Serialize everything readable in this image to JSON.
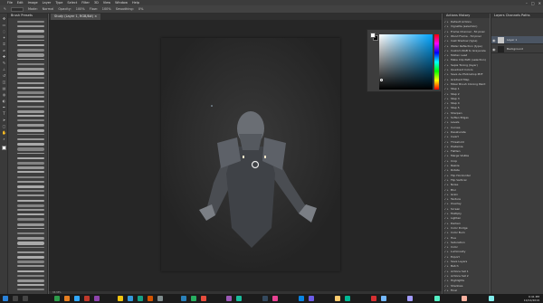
{
  "menubar": {
    "items": [
      "File",
      "Edit",
      "Image",
      "Layer",
      "Type",
      "Select",
      "Filter",
      "3D",
      "View",
      "Window",
      "Help"
    ]
  },
  "optionsbar": {
    "mode_label": "Mode:",
    "mode_value": "Normal",
    "opacity_label": "Opacity:",
    "opacity_value": "100%",
    "flow_label": "Flow:",
    "flow_value": "100%",
    "smoothing_label": "Smoothing:",
    "smoothing_value": "0%"
  },
  "brush_panel": {
    "title": "Brush Presets"
  },
  "document": {
    "tab_title": "Study (Layer 1, RGB/8#) ×"
  },
  "status": {
    "zoom": "33.33%"
  },
  "color": {
    "foreground": "#ffffff",
    "background": "#000000",
    "hue_accent": "#00a5ff"
  },
  "actions_panel": {
    "tabs": [
      "Actions",
      "History"
    ],
    "items": [
      "Default Actions",
      "Vignette (selection)",
      "Frame Channel - 50 pixel",
      "Wood Frame - 50 pixel",
      "Cast Shadow (type)",
      "Water Reflection (type)",
      "Custom RGB to Grayscale",
      "Molten Lead",
      "Make Clip Path (selection)",
      "Sepia Toning (layer)",
      "Quadrant Colors",
      "Save As Photoshop PDF",
      "Gradient Map",
      "Mixer Brush Cloning Paint",
      "Step 1",
      "Step 2",
      "Step 3",
      "Step 4",
      "Step 5",
      "Sharpen",
      "Soften Edges",
      "Levels",
      "Curves",
      "Desaturate",
      "Invert",
      "Threshold",
      "Posterize",
      "Flatten",
      "Merge Visible",
      "Crop",
      "Resize",
      "Rotate",
      "Flip Horizontal",
      "Flip Vertical",
      "Noise",
      "Blur",
      "Grain",
      "Texture",
      "Overlay",
      "Screen",
      "Multiply",
      "Lighten",
      "Darken",
      "Color Dodge",
      "Color Burn",
      "Hue",
      "Saturation",
      "Color",
      "Luminosity",
      "Export",
      "Save Layers",
      "Batch",
      "Actions Set 1",
      "Actions Set 2",
      "Highlights",
      "Shadows",
      "Final"
    ]
  },
  "layers_panel": {
    "tabs": [
      "Layers",
      "Channels",
      "Paths"
    ],
    "layers": [
      {
        "name": "Layer 1",
        "thumb_color": "#c8c8c8"
      },
      {
        "name": "Background",
        "thumb_color": "#222222"
      }
    ]
  },
  "taskbar": {
    "time": "9:41 PM",
    "date": "10/12/2019"
  }
}
